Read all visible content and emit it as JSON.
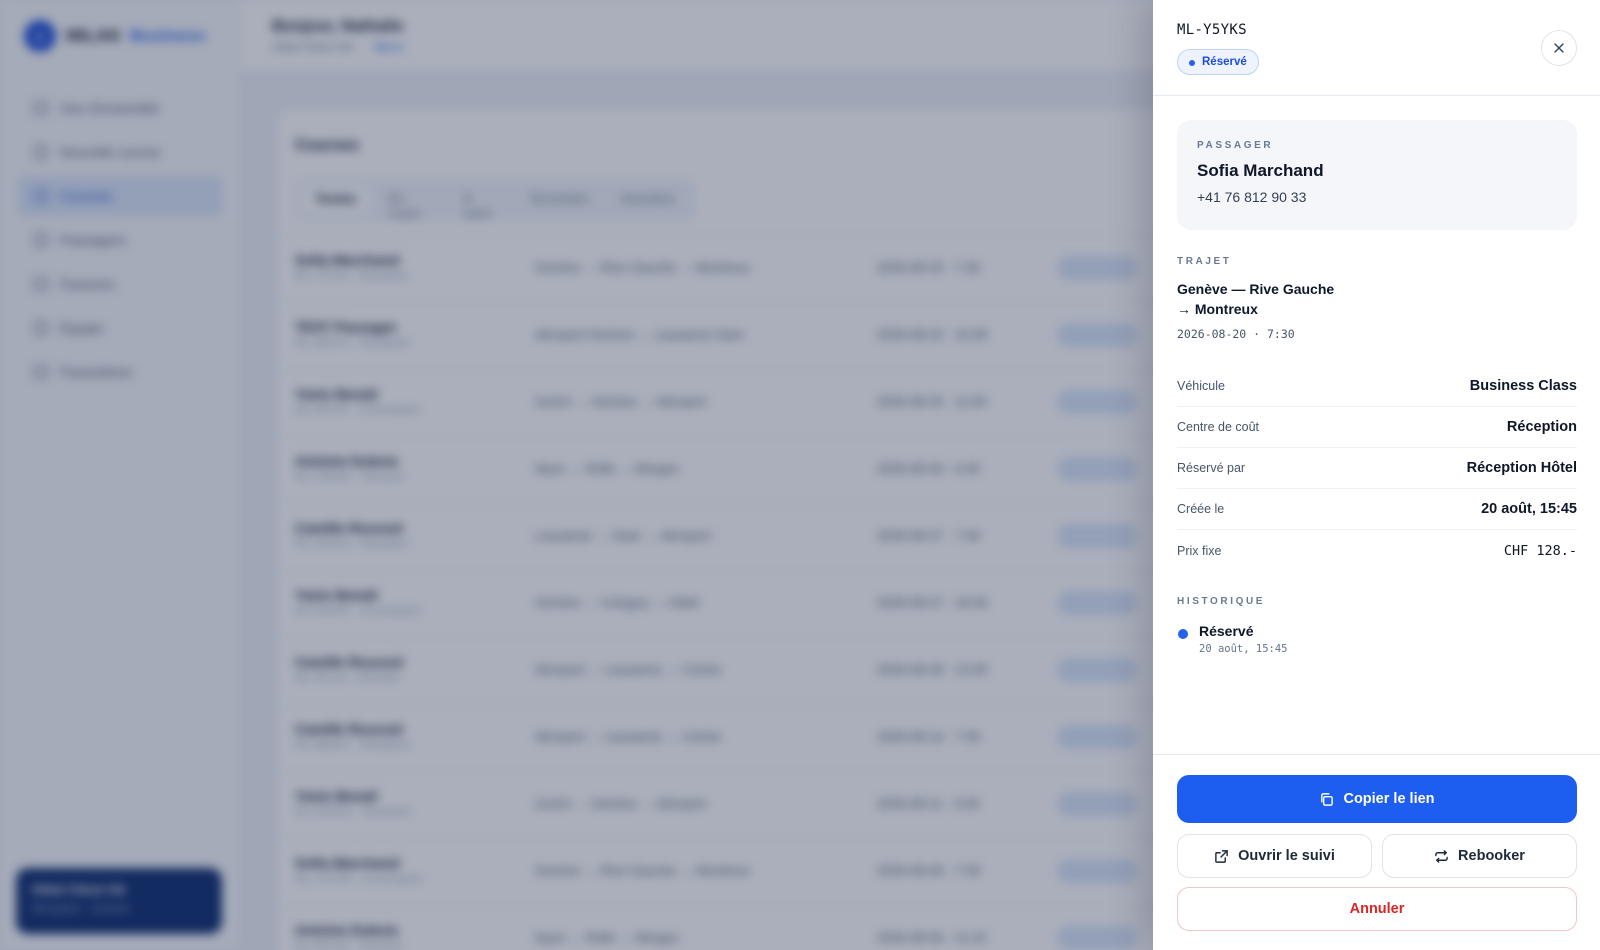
{
  "background": {
    "brand": {
      "name": "MILAN",
      "accent": "Business"
    },
    "nav": [
      "Vue d'ensemble",
      "Nouvelle course",
      "Courses",
      "Passagers",
      "Factures",
      "Équipe",
      "Paramètres"
    ],
    "hotel": {
      "name": "Hôtel Client SA",
      "sub": "Réception · Genève"
    },
    "topbar": {
      "title": "Bonjour, Nathalie",
      "sub": "Hôtel Client SA",
      "link": "Menu"
    },
    "panel_title": "Courses",
    "tabs": [
      "Toutes",
      "En cours",
      "À venir",
      "Terminées",
      "Annulées"
    ],
    "rows": [
      {
        "name": "Sofia Marchand",
        "sub": "ML-Y5YKS · Réception",
        "route": "Genève → Rive Gauche → Montreux",
        "date": "2026-08-20 · 7:30"
      },
      {
        "name": "TEST Passager",
        "sub": "ML-QR2TX · Réception",
        "route": "Aéroport Genève → Lausanne Gare",
        "date": "2026-08-22 · 10:30"
      },
      {
        "name": "Yanis Benali",
        "sub": "ML-8PKVA · Conciergerie",
        "route": "Zurich → Genève → Aéroport",
        "date": "2026-08-25 · 11:00"
      },
      {
        "name": "Antoine Dubois",
        "sub": "ML-7MHRZ · Direction",
        "route": "Nyon → Rolle → Morges",
        "date": "2026-08-26 · 6:45"
      },
      {
        "name": "Camille Roussel",
        "sub": "ML-3VKEN · Réception",
        "route": "Lausanne → Gare → Aéroport",
        "date": "2026-08-27 · 7:30"
      },
      {
        "name": "Yanis Benali",
        "sub": "ML-9JDHR · Conciergerie",
        "route": "Genève → Cologny → Hôtel",
        "date": "2026-08-27 · 18:30"
      },
      {
        "name": "Camille Roussel",
        "sub": "ML-4FLAX · Direction",
        "route": "Aéroport → Lausanne → Centre",
        "date": "2026-08-28 · 13:30"
      },
      {
        "name": "Camille Roussel",
        "sub": "ML-6BQNT · Réception",
        "route": "Aéroport → Lausanne → Centre",
        "date": "2026-08-14 · 7:30"
      },
      {
        "name": "Yanis Benali",
        "sub": "ML-2ZWUE · Réception",
        "route": "Zurich → Genève → Aéroport",
        "date": "2026-08-11 · 5:00"
      },
      {
        "name": "Sofia Marchand",
        "sub": "ML-1TCPM · Conciergerie",
        "route": "Genève → Rive Gauche → Montreux",
        "date": "2026-08-09 · 7:30"
      },
      {
        "name": "Antoine Dubois",
        "sub": "ML-5NYGF · Direction",
        "route": "Nyon → Rolle → Morges",
        "date": "2026-08-06 · 11:15"
      }
    ]
  },
  "drawer": {
    "reference": "ML-Y5YKS",
    "status": "Réservé",
    "passenger": {
      "eyebrow": "PASSAGER",
      "name": "Sofia Marchand",
      "phone": "+41 76 812 90 33"
    },
    "trip": {
      "eyebrow": "TRAJET",
      "route_line1": "Genève — Rive Gauche",
      "route_line2": "→ Montreux",
      "datetime": "2026-08-20 · 7:30"
    },
    "details": [
      {
        "label": "Véhicule",
        "value": "Business Class"
      },
      {
        "label": "Centre de coût",
        "value": "Réception"
      },
      {
        "label": "Réservé par",
        "value": "Réception Hôtel"
      },
      {
        "label": "Créée le",
        "value": "20 août, 15:45"
      },
      {
        "label": "Prix fixe",
        "value": "CHF 128.-"
      }
    ],
    "history": {
      "eyebrow": "HISTORIQUE",
      "items": [
        {
          "title": "Réservé",
          "time": "20 août, 15:45"
        }
      ]
    },
    "actions": {
      "copy": "Copier le lien",
      "track": "Ouvrir le suivi",
      "rebook": "Rebooker",
      "cancel": "Annuler"
    }
  },
  "colors": {
    "primary": "#1d5ef0",
    "danger": "#dc2626",
    "status_blue": "#2563eb"
  },
  "icons": {
    "close": "close-icon",
    "copy": "copy-icon",
    "track": "external-link-icon",
    "rebook": "repeat-icon"
  }
}
